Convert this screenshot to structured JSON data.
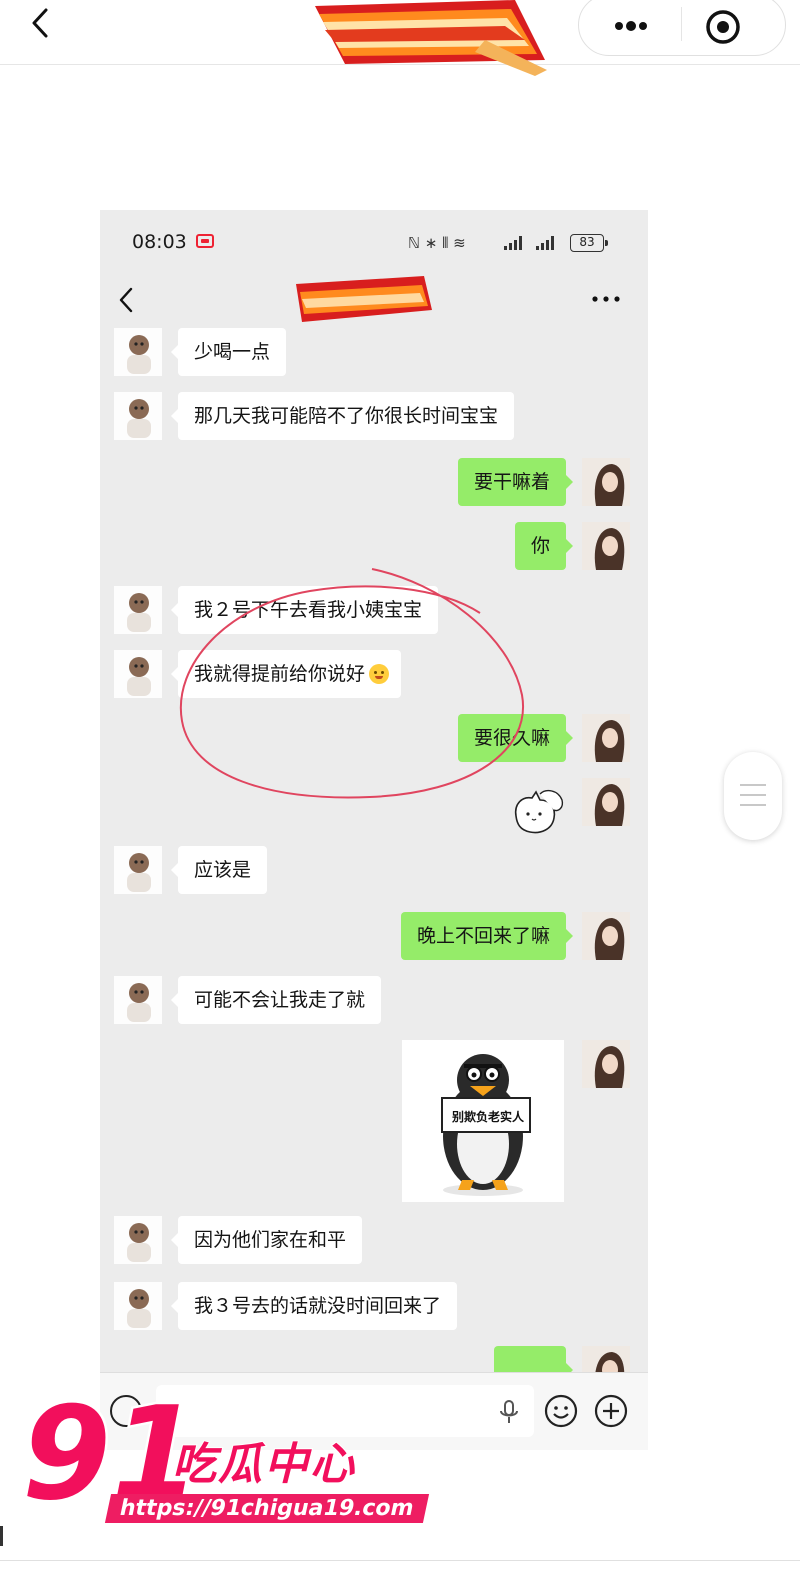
{
  "status_bar": {
    "time": "08:03",
    "battery": "83"
  },
  "messages": [
    {
      "side": "left",
      "text": "少喝一点"
    },
    {
      "side": "left",
      "text": "那几天我可能陪不了你很长时间宝宝"
    },
    {
      "side": "right",
      "text": "要干嘛着"
    },
    {
      "side": "right",
      "text": "你"
    },
    {
      "side": "left",
      "text": "我２号下午去看我小姨宝宝"
    },
    {
      "side": "left",
      "text": "我就得提前给你说好"
    },
    {
      "side": "right",
      "text": "要很久嘛"
    },
    {
      "side": "left",
      "text": "应该是"
    },
    {
      "side": "right",
      "text": "晚上不回来了嘛"
    },
    {
      "side": "left",
      "text": "可能不会让我走了就"
    },
    {
      "side": "left",
      "text": "因为他们家在和平"
    },
    {
      "side": "left",
      "text": "我３号去的话就没时间回来了"
    }
  ],
  "sticker": {
    "sign_text": "别欺负老实人"
  },
  "watermark": {
    "number": "91",
    "brand": "吃瓜中心",
    "url": "https://91chigua19.com"
  },
  "colors": {
    "bubble_self": "#95ec69",
    "bubble_other": "#ffffff",
    "chat_bg": "#ececec",
    "annotation_circle": "#e0455f",
    "watermark": "#f20f5c"
  },
  "icons": [
    "back-icon",
    "more-icon",
    "record-icon",
    "voice-icon",
    "mic-icon",
    "emoji-icon",
    "plus-icon"
  ]
}
